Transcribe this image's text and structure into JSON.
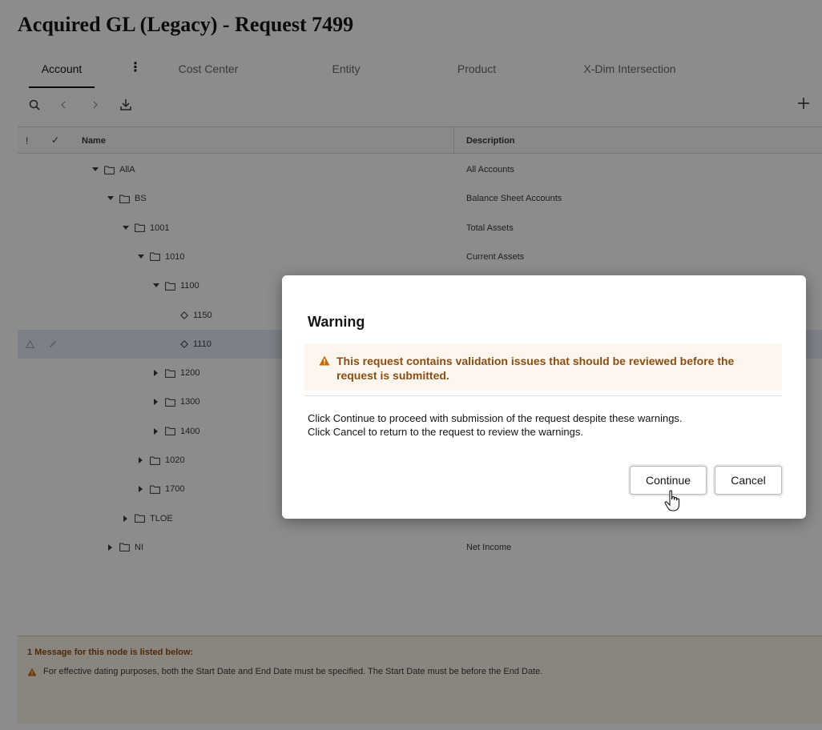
{
  "page": {
    "title": "Acquired GL (Legacy) - Request 7499"
  },
  "tabs": [
    {
      "label": "Account",
      "active": true
    },
    {
      "label": "Cost Center",
      "active": false
    },
    {
      "label": "Entity",
      "active": false
    },
    {
      "label": "Product",
      "active": false
    },
    {
      "label": "X-Dim Intersection",
      "active": false
    }
  ],
  "toolbar": {
    "icons": [
      "search-icon",
      "chevron-left-icon",
      "chevron-right-icon",
      "download-icon",
      "plus-icon"
    ]
  },
  "grid": {
    "columns": {
      "indicator": "!",
      "check": "✓",
      "name": "Name",
      "description": "Description"
    },
    "rows": [
      {
        "name": "AllA",
        "description": "All Accounts",
        "level": 0,
        "expanded": true,
        "leaf": false
      },
      {
        "name": "BS",
        "description": "Balance Sheet Accounts",
        "level": 1,
        "expanded": true,
        "leaf": false
      },
      {
        "name": "1001",
        "description": "Total Assets",
        "level": 2,
        "expanded": true,
        "leaf": false
      },
      {
        "name": "1010",
        "description": "Current Assets",
        "level": 3,
        "expanded": true,
        "leaf": false
      },
      {
        "name": "1100",
        "description": "",
        "level": 4,
        "expanded": true,
        "leaf": false
      },
      {
        "name": "1150",
        "description": "",
        "level": 5,
        "leaf": true
      },
      {
        "name": "1110",
        "description": "",
        "level": 5,
        "leaf": true,
        "selected": true
      },
      {
        "name": "1200",
        "description": "",
        "level": 4,
        "expanded": false,
        "leaf": false
      },
      {
        "name": "1300",
        "description": "",
        "level": 4,
        "expanded": false,
        "leaf": false
      },
      {
        "name": "1400",
        "description": "",
        "level": 4,
        "expanded": false,
        "leaf": false
      },
      {
        "name": "1020",
        "description": "",
        "level": 3,
        "expanded": false,
        "leaf": false
      },
      {
        "name": "1700",
        "description": "",
        "level": 3,
        "expanded": false,
        "leaf": false
      },
      {
        "name": "TLOE",
        "description": "",
        "level": 2,
        "expanded": false,
        "leaf": false
      },
      {
        "name": "NI",
        "description": "Net Income",
        "level": 1,
        "expanded": false,
        "leaf": false
      }
    ]
  },
  "messages": {
    "title": "1 Message for this node is listed below:",
    "items": [
      "For effective dating purposes, both the Start Date and End Date must be specified. The Start Date must be before the End Date."
    ]
  },
  "dialog": {
    "title": "Warning",
    "warning": "This request contains validation issues that should be reviewed before the request is submitted.",
    "body_line1": "Click Continue to proceed with submission of the request despite these warnings.",
    "body_line2": "Click Cancel to return to the request to review the warnings.",
    "continue_label": "Continue",
    "cancel_label": "Cancel"
  },
  "colors": {
    "warning": "#c46c00",
    "selected_row": "#e4ecf6",
    "overlay": "rgba(0,0,0,0.45)"
  }
}
